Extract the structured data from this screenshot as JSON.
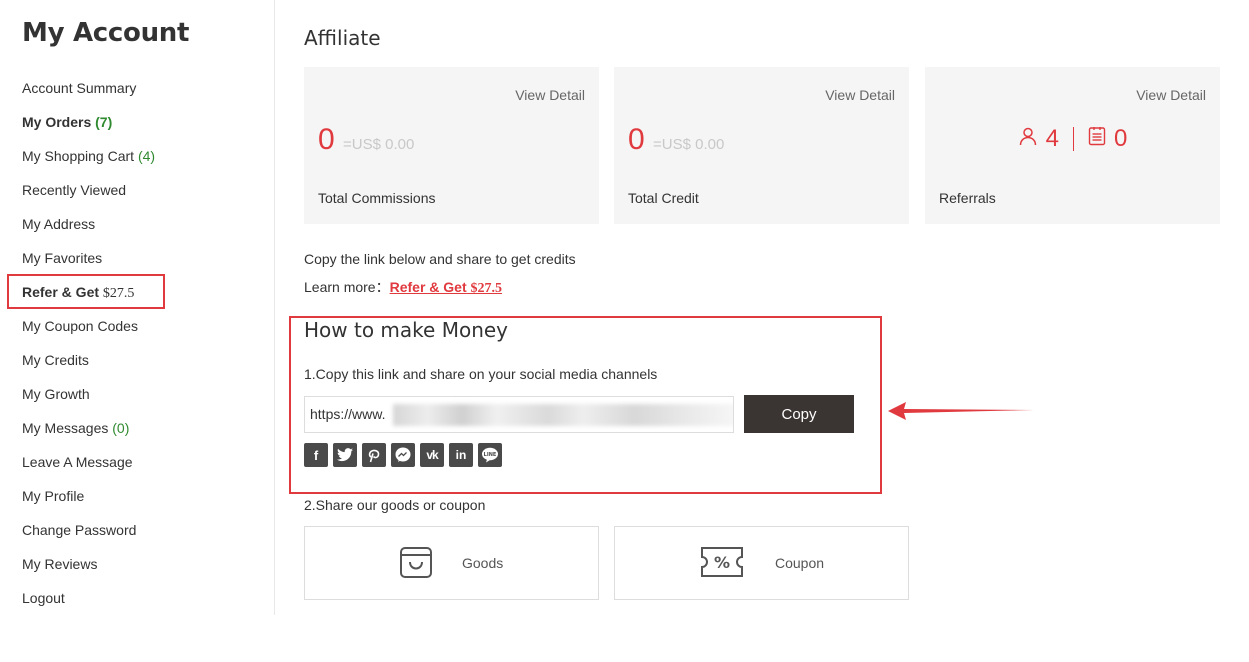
{
  "sidebar": {
    "title": "My Account",
    "items": [
      {
        "label": "Account Summary"
      },
      {
        "label": "My Orders",
        "count": "(7)"
      },
      {
        "label": "My Shopping Cart",
        "count": "(4)"
      },
      {
        "label": "Recently Viewed"
      },
      {
        "label": "My Address"
      },
      {
        "label": "My Favorites"
      },
      {
        "label": "Refer & Get",
        "amount": "$27.5"
      },
      {
        "label": "My Coupon Codes"
      },
      {
        "label": "My Credits"
      },
      {
        "label": "My Growth"
      },
      {
        "label": "My Messages",
        "count": "(0)"
      },
      {
        "label": "Leave A Message"
      },
      {
        "label": "My Profile"
      },
      {
        "label": "Change Password"
      },
      {
        "label": "My Reviews"
      },
      {
        "label": "Logout"
      }
    ]
  },
  "main": {
    "title": "Affiliate",
    "cards": [
      {
        "view": "View Detail",
        "value": "0",
        "equiv": "=US$ 0.00",
        "label": "Total Commissions"
      },
      {
        "view": "View Detail",
        "value": "0",
        "equiv": "=US$ 0.00",
        "label": "Total Credit"
      },
      {
        "view": "View Detail",
        "referrals": "4",
        "orders": "0",
        "label": "Referrals"
      }
    ],
    "share_intro": "Copy the link below and share to get credits",
    "learn_more": "Learn more：",
    "learn_link": "Refer & Get",
    "learn_amount": "$27.5",
    "howto": {
      "title": "How to make Money",
      "step1": "1.Copy this link and share on your social media channels",
      "link_value": "https://www.",
      "copy_label": "Copy",
      "socials": [
        "facebook-icon",
        "twitter-icon",
        "pinterest-icon",
        "messenger-icon",
        "vk-icon",
        "linkedin-icon",
        "line-icon"
      ]
    },
    "step2": "2.Share our goods or coupon",
    "goods_label": "Goods",
    "coupon_label": "Coupon"
  },
  "colors": {
    "accent": "#e0393e",
    "count": "#2f8a2f",
    "button": "#3a3432",
    "card_bg": "#f5f5f5"
  }
}
